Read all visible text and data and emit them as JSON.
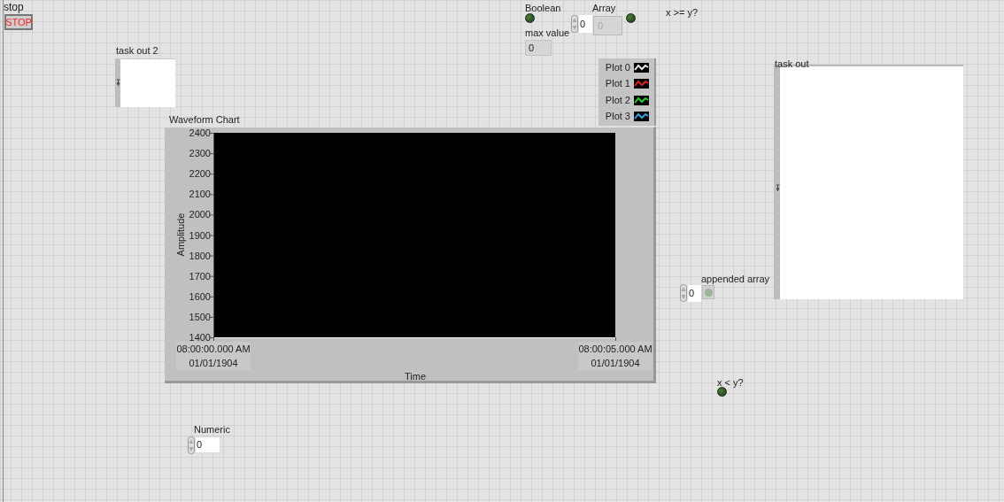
{
  "stop": {
    "label": "stop",
    "button": "STOP"
  },
  "task_out_2": {
    "label": "task out 2"
  },
  "boolean": {
    "label": "Boolean",
    "on": false
  },
  "array": {
    "label": "Array",
    "index": "0",
    "element": "0",
    "element_disabled": true,
    "led_on": false
  },
  "x_ge_y": {
    "label": "x >= y?"
  },
  "max_value": {
    "label": "max value",
    "value": "0"
  },
  "legend": [
    {
      "name": "Plot 0",
      "color": "#e8e8e8"
    },
    {
      "name": "Plot 1",
      "color": "#e02020"
    },
    {
      "name": "Plot 2",
      "color": "#20d020"
    },
    {
      "name": "Plot 3",
      "color": "#3aa0e0"
    }
  ],
  "waveform_chart": {
    "label": "Waveform Chart",
    "chart_data": {
      "type": "line",
      "xlabel": "Time",
      "ylabel": "Amplitude",
      "ylim": [
        1400,
        2400
      ],
      "categories": [
        "08:00:00.000 AM\n01/01/1904",
        "08:00:05.000 AM\n01/01/1904"
      ],
      "yticks": [
        1400,
        1500,
        1600,
        1700,
        1800,
        1900,
        2000,
        2100,
        2200,
        2300,
        2400
      ]
    }
  },
  "task_out": {
    "label": "task out"
  },
  "appended_array": {
    "label": "appended array",
    "index": "0",
    "led_on": false,
    "disabled": true
  },
  "x_lt_y": {
    "label": "x < y?",
    "on": false
  },
  "numeric": {
    "label": "Numeric",
    "value": "0"
  }
}
